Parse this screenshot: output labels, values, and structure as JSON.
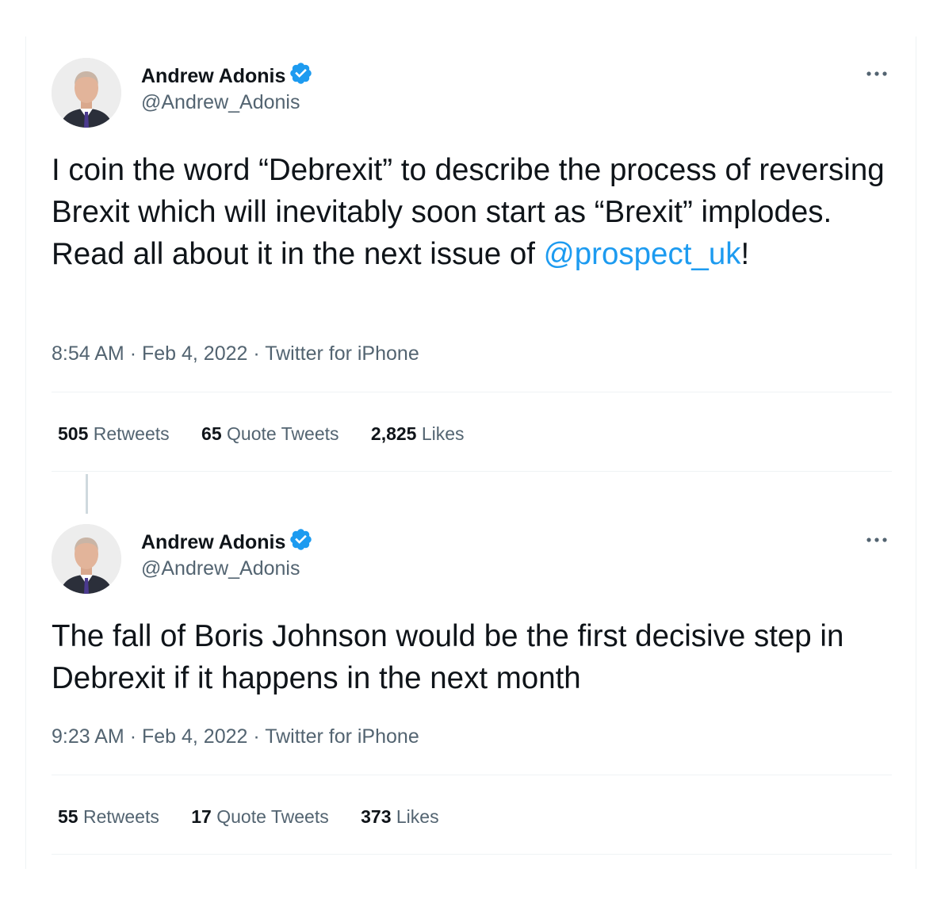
{
  "tweets": [
    {
      "author_name": "Andrew Adonis",
      "handle": "@Andrew_Adonis",
      "text_before": "I coin the word “Debrexit” to describe the process of reversing Brexit which will inevitably soon start as “Brexit” implodes. Read all about it in the next issue of ",
      "mention": "@prospect_uk",
      "text_after": "!",
      "time": "8:54 AM",
      "date": "Feb 4, 2022",
      "source": "Twitter for iPhone",
      "retweets_count": "505",
      "retweets_label": "Retweets",
      "quotes_count": "65",
      "quotes_label": "Quote Tweets",
      "likes_count": "2,825",
      "likes_label": "Likes"
    },
    {
      "author_name": "Andrew Adonis",
      "handle": "@Andrew_Adonis",
      "text_before": "The fall of Boris Johnson would be the first decisive step in Debrexit if it happens in the next month",
      "mention": "",
      "text_after": "",
      "time": "9:23 AM",
      "date": "Feb 4, 2022",
      "source": "Twitter for iPhone",
      "retweets_count": "55",
      "retweets_label": "Retweets",
      "quotes_count": "17",
      "quotes_label": "Quote Tweets",
      "likes_count": "373",
      "likes_label": "Likes"
    }
  ],
  "separator": "·",
  "colors": {
    "text": "#0f1419",
    "secondary": "#536471",
    "link": "#1d9bf0",
    "verified": "#1d9bf0",
    "divider": "#eff3f4"
  },
  "icons": {
    "verified": "verified-badge-icon",
    "more": "more-options-icon"
  }
}
